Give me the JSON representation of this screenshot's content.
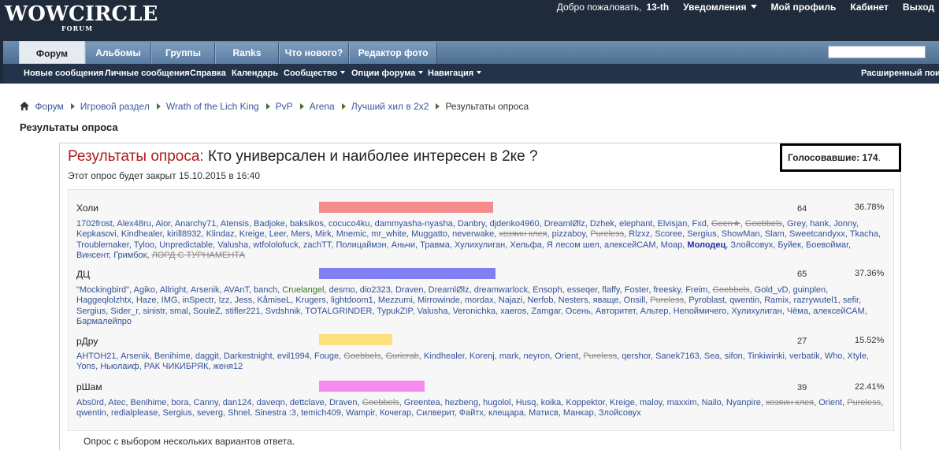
{
  "header": {
    "logo": "WOWCIRCLE",
    "logo_sub": "FORUM",
    "welcome": "Добро пожаловать,",
    "username": "13-th",
    "notifications": "Уведомления",
    "profile": "Мой профиль",
    "cabinet": "Кабинет",
    "logout": "Выход"
  },
  "tabs": [
    "Форум",
    "Альбомы",
    "Группы",
    "Ranks",
    "Что нового?",
    "Редактор фото"
  ],
  "subnav": {
    "items": [
      "Новые сообщения",
      "Личные сообщения",
      "Справка",
      "Календарь",
      "Сообщество",
      "Опции форума",
      "Навигация"
    ],
    "advanced_search": "Расширенный поис"
  },
  "breadcrumb": [
    "Форум",
    "Игровой раздел",
    "Wrath of the Lich King",
    "PvP",
    "Arena",
    "Лучший хил в 2х2",
    "Результаты опроса"
  ],
  "page_title": "Результаты опроса",
  "poll": {
    "label": "Результаты опроса:",
    "question": "Кто универсален и наиболее интересен в 2ке ?",
    "closes": "Этот опрос будет закрыт 15.10.2015 в 16:40",
    "voters": "Голосовавшие: 174",
    "voters_tail": ".",
    "multi_note": "Опрос с выбором нескольких вариантов ответа.",
    "options": [
      {
        "name": "Холи",
        "count": "64",
        "percent": "36.78%",
        "fraction": 0.3678,
        "color": "#f48c8c",
        "voters": [
          "1702frost",
          "Alex48ru",
          "Alor",
          "Anarchy71",
          "Atensis",
          "Badjoke",
          "baksikos",
          "cocuco4ku",
          "dammyasha-nyasha",
          "Danbry",
          "djdenko4960",
          "DreamlØlz",
          "Dzhek",
          "elephant",
          "Elvisjan",
          "Fxd",
          {
            "t": "Geen★",
            "s": true
          },
          {
            "t": "Goebbels",
            "s": true
          },
          "Grey",
          "hank",
          "Jonny",
          "Kepkasovi",
          "Kindhealer",
          "kirill8932",
          "Klindaz",
          "Kreige",
          "Leer",
          "Mers",
          "Mirk",
          "Mnemic",
          "mr_white",
          "Muggatto",
          "neverwake",
          {
            "t": "хозяин клея",
            "s": true
          },
          "pizzaboy",
          {
            "t": "Pureless",
            "s": true
          },
          "Rlzxz",
          "Scoree",
          "Sergius",
          "ShowMan",
          "Slam",
          "Sweetcandyxx",
          "Tkacha",
          "Troublemaker",
          "Tyloo",
          "Unpredictable",
          "Valusha",
          "wtfololofuck",
          "zachTT",
          "Полицаймэн",
          "Аньчи",
          "Травма",
          "Хулихулиган",
          "Хельфа",
          "Я лесом шел",
          "алексейСАМ",
          "Моар",
          {
            "t": "Молодец",
            "b": true
          },
          "Злойсовух",
          "Буйек",
          "Боевоймаг",
          "Винсент",
          "Гримбок",
          {
            "t": "ЛОРД С ТУРНАМЕНТА",
            "s": true
          }
        ]
      },
      {
        "name": "ДЦ",
        "count": "65",
        "percent": "37.36%",
        "fraction": 0.3736,
        "color": "#8080f2",
        "voters": [
          "\"Mockingbird\"",
          "Agiko",
          "Allright",
          "Arsenik",
          "AVAnT",
          "banch",
          {
            "t": "Cruelangel",
            "g": true
          },
          "desmo",
          "dio2323",
          "Draven",
          "DreamlØlz",
          "dreamwarlock",
          "Ensoph",
          "esseqer",
          "flaffy",
          "Foster",
          "freesky",
          "Freim",
          {
            "t": "Goebbels",
            "s": true
          },
          "Gold_vD",
          "guinplen",
          "Haggeqlolzhtx",
          "Haze",
          "IMG",
          "inSpectr",
          "Izz",
          "Jess",
          "KåmiseL",
          "Krugers",
          "lightdoom1",
          "Mezzumi",
          "Mirrowinde",
          "mordax",
          "Najazi",
          "Nerfob",
          "Nesters",
          "яваще",
          "Onsill",
          {
            "t": "Pureless",
            "s": true
          },
          "Pyroblast",
          "qwentin",
          "Ramix",
          "razrywutel1",
          "sefir",
          "Sergius",
          "Sider_r",
          "sinistr",
          "smal",
          "SouleZ",
          "stifler221",
          "Svdshnik",
          "TOTALGRINDER",
          "TypukZIP",
          "Valusha",
          "Veronichka",
          "xaeros",
          "Zamgar",
          "Осень",
          "Авторитет",
          "Альтер",
          "Непоймичего",
          "Хулихулиган",
          "Чёма",
          "алексейСАМ",
          "Бармалейпро"
        ]
      },
      {
        "name": "рДру",
        "count": "27",
        "percent": "15.52%",
        "fraction": 0.1552,
        "color": "#fde07e",
        "voters": [
          "AHTOH21",
          "Arsenik",
          "Benihime",
          "daggit",
          "Darkestnight",
          "evil1994",
          "Fouge",
          {
            "t": "Goebbels",
            "s": true
          },
          {
            "t": "Guricrab",
            "s": true
          },
          "Kindhealer",
          "Korenj",
          "mark",
          "neyron",
          "Orient",
          {
            "t": "Pureless",
            "s": true
          },
          "qershor",
          "Sanek7163",
          "Sea",
          "sifon",
          "Tinkiwinki",
          "verbatik",
          "Who",
          "Xtyle",
          "Yons",
          "Ньюлаиф",
          "РАК ЧИКИБРЯК",
          "женя12"
        ]
      },
      {
        "name": "рШам",
        "count": "39",
        "percent": "22.41%",
        "fraction": 0.2241,
        "color": "#f68cf1",
        "voters": [
          "Abs0rd",
          "Atec",
          "Benihime",
          "bora",
          "Canny",
          "dan124",
          "daveqn",
          "dettclave",
          "Draven",
          {
            "t": "Goebbels",
            "s": true
          },
          "Greentea",
          "hezbeng",
          "hugolol",
          "Husq",
          "koika",
          "Koppektor",
          "Kreige",
          "maloy",
          "maxxim",
          "Nailo",
          "Nyanpire",
          {
            "t": "хозяин клея",
            "s": true
          },
          "Orient",
          {
            "t": "Pureless",
            "s": true
          },
          "qwentin",
          "redialplease",
          "Sergius",
          "severg",
          "Shnel",
          "Sinestra :3",
          "temich409",
          "Wampir",
          "Кочегар",
          "Силверит",
          "Файтх",
          "клещара",
          "Матисв",
          "Манкар",
          "Злойсовух"
        ]
      }
    ]
  }
}
